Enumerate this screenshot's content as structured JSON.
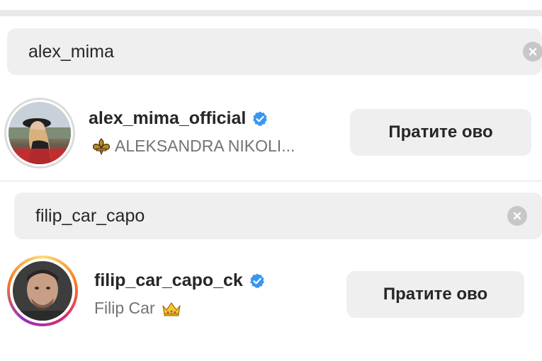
{
  "results": [
    {
      "search_query": "alex_mima",
      "username": "alex_mima_official",
      "verified": true,
      "display_name": "ALEKSANDRA NIKOLI...",
      "name_prefix_icon": "fleur-de-lis-icon",
      "follow_label": "Пратите ово"
    },
    {
      "search_query": "filip_car_capo",
      "username": "filip_car_capo_ck",
      "verified": true,
      "display_name": "Filip Car",
      "name_suffix_icon": "crown-icon",
      "follow_label": "Пратите ово"
    }
  ],
  "colors": {
    "verified_badge": "#3897f0",
    "search_bg": "#efeff0",
    "button_bg": "#efeff0",
    "story_ring": [
      "#feda75",
      "#fa7e1e",
      "#d62976",
      "#962fbf"
    ]
  }
}
